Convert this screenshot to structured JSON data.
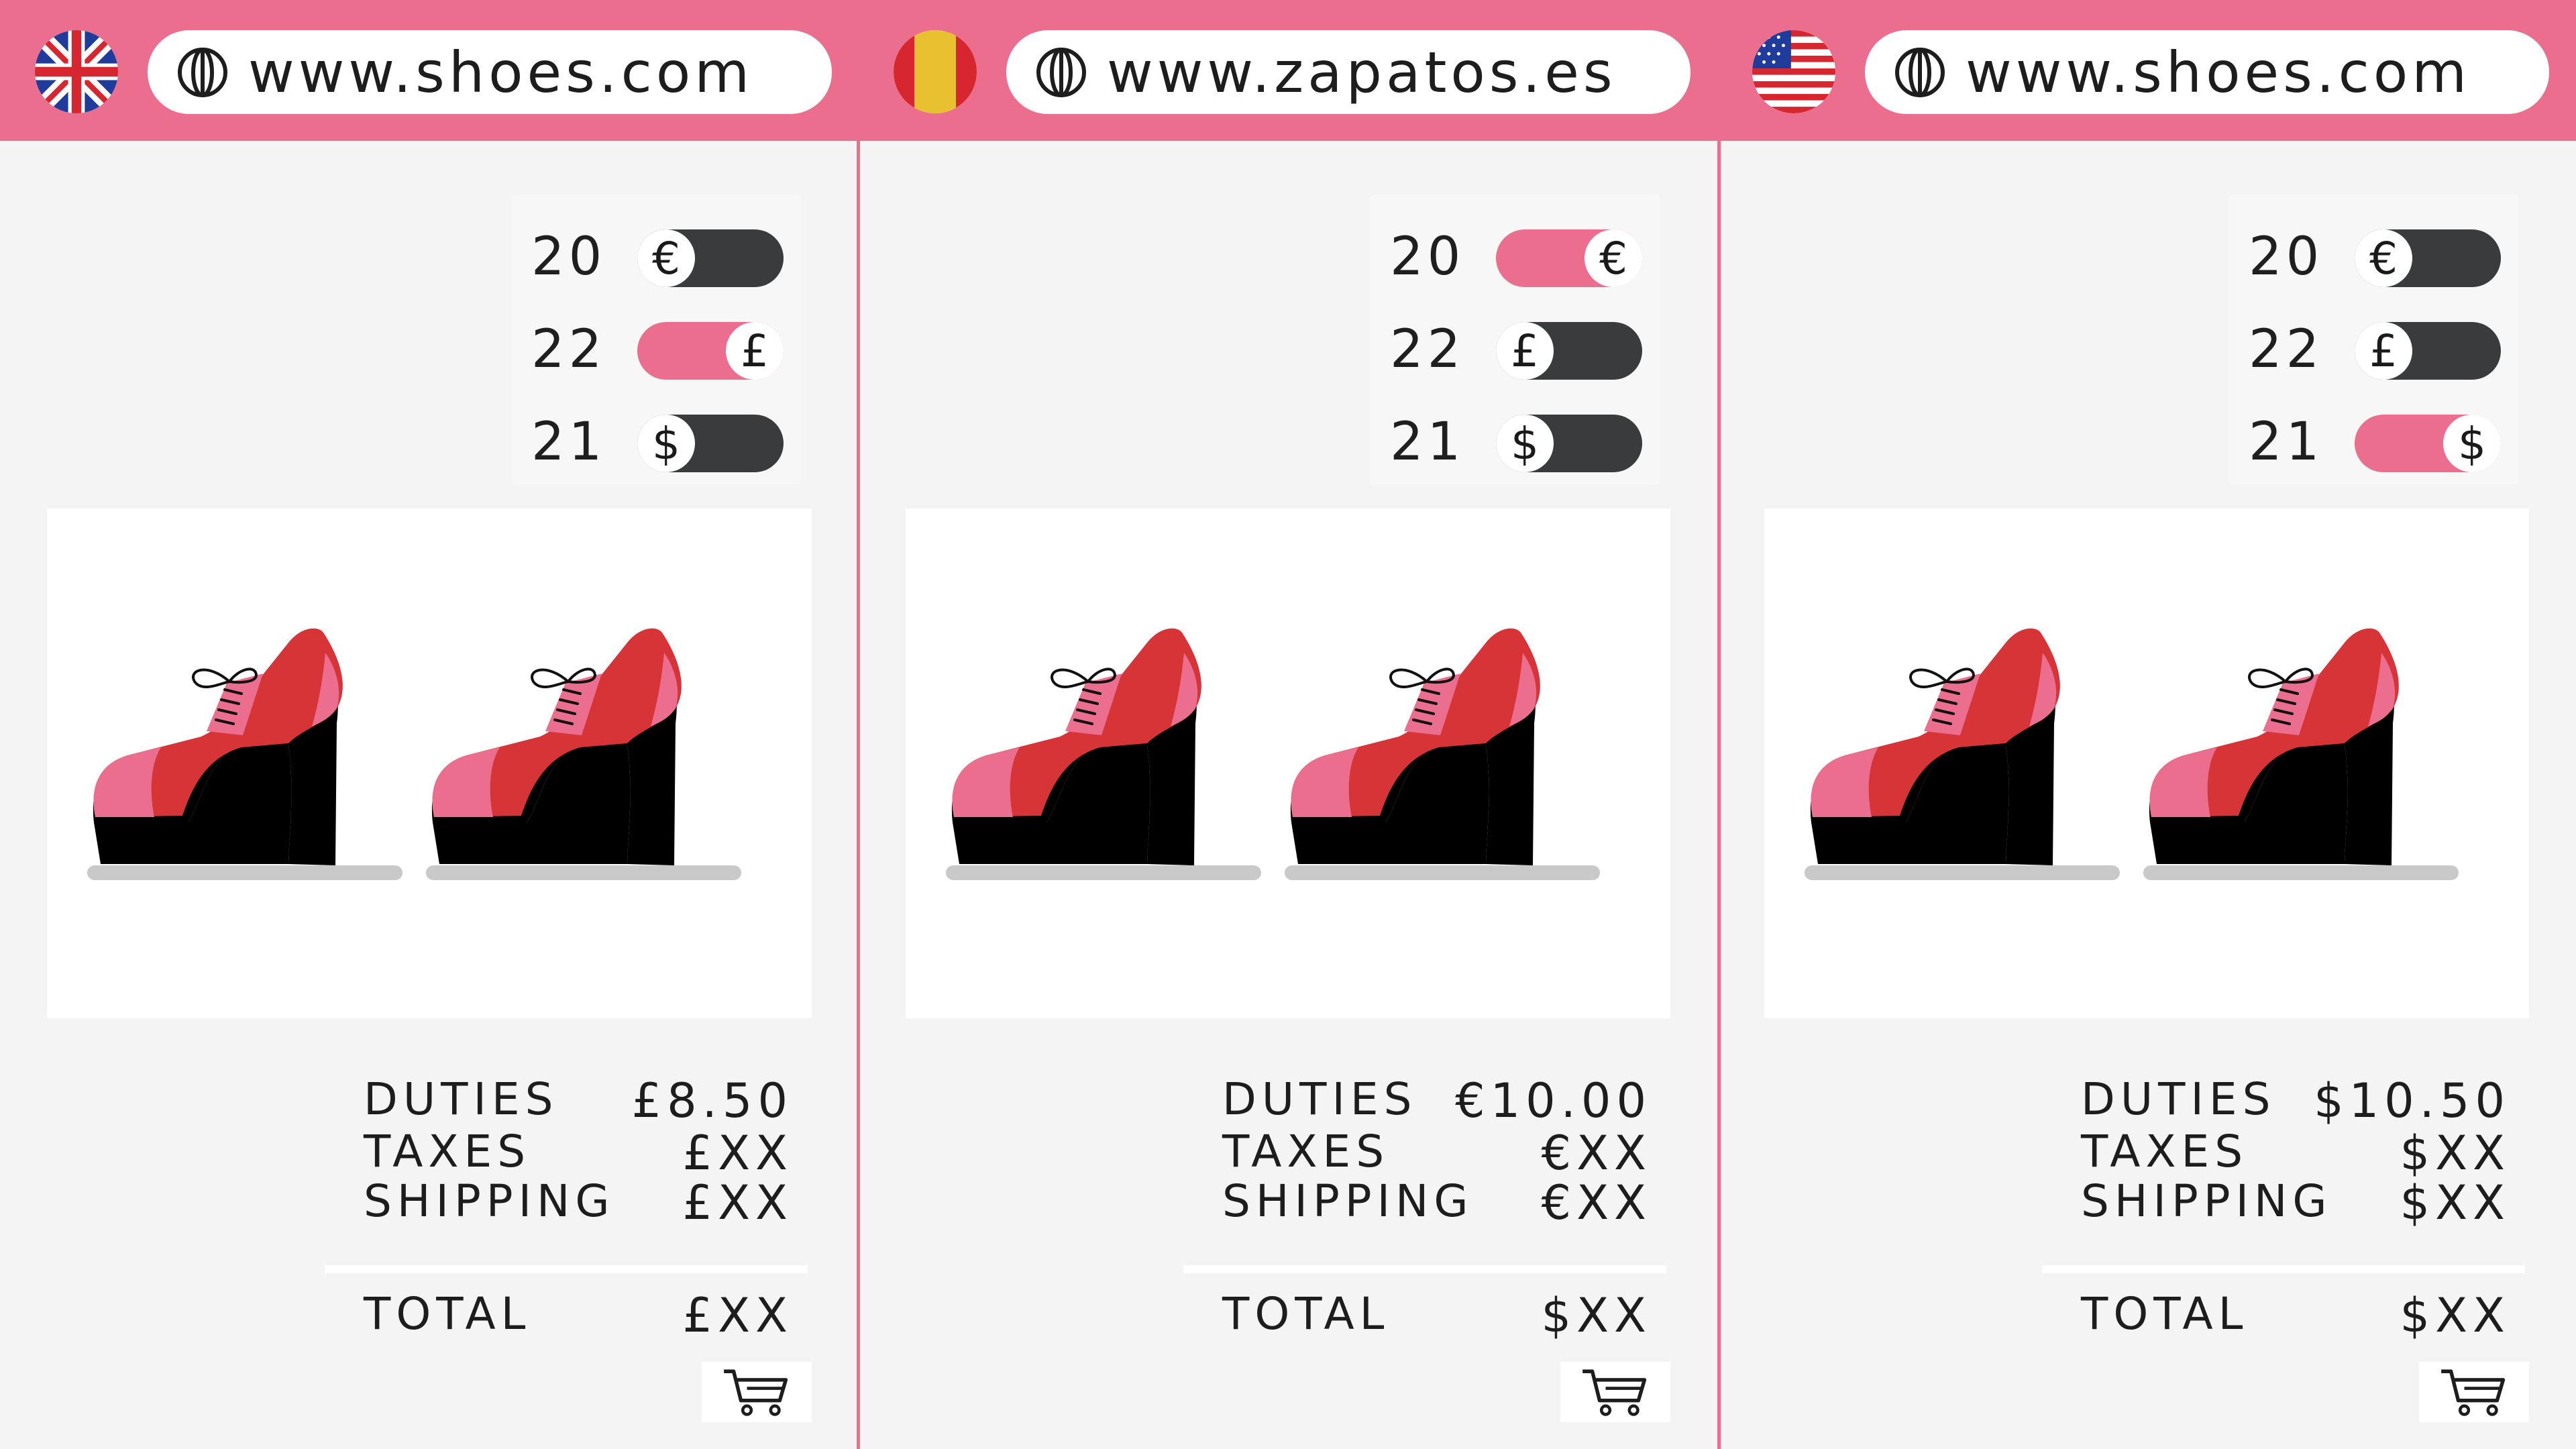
{
  "colors": {
    "accent": "#ec6e8f",
    "toggle_off": "#3a3b3d",
    "shoe_red": "#d73438",
    "shoe_pink": "#ec6e8f",
    "sole": "#000000"
  },
  "icons": {
    "globe": "globe-icon",
    "cart": "shopping-cart-icon"
  },
  "panels": [
    {
      "region": "UK",
      "flag": "uk-flag-icon",
      "url": "www.shoes.com",
      "sizes": [
        {
          "number": "20",
          "currency": "€",
          "selected": false
        },
        {
          "number": "22",
          "currency": "£",
          "selected": true
        },
        {
          "number": "21",
          "currency": "$",
          "selected": false
        }
      ],
      "summary": {
        "duties_label": "DUTIES",
        "duties_value": "£8.50",
        "taxes_label": "TAXES",
        "taxes_value": "£XX",
        "shipping_label": "SHIPPING",
        "shipping_value": "£XX",
        "total_label": "TOTAL",
        "total_value": "£XX"
      }
    },
    {
      "region": "Spain",
      "flag": "spain-flag-icon",
      "url": "www.zapatos.es",
      "sizes": [
        {
          "number": "20",
          "currency": "€",
          "selected": true
        },
        {
          "number": "22",
          "currency": "£",
          "selected": false
        },
        {
          "number": "21",
          "currency": "$",
          "selected": false
        }
      ],
      "summary": {
        "duties_label": "DUTIES",
        "duties_value": "€10.00",
        "taxes_label": "TAXES",
        "taxes_value": "€XX",
        "shipping_label": "SHIPPING",
        "shipping_value": "€XX",
        "total_label": "TOTAL",
        "total_value": "$XX"
      }
    },
    {
      "region": "US",
      "flag": "us-flag-icon",
      "url": "www.shoes.com",
      "sizes": [
        {
          "number": "20",
          "currency": "€",
          "selected": false
        },
        {
          "number": "22",
          "currency": "£",
          "selected": false
        },
        {
          "number": "21",
          "currency": "$",
          "selected": true
        }
      ],
      "summary": {
        "duties_label": "DUTIES",
        "duties_value": "$10.50",
        "taxes_label": "TAXES",
        "taxes_value": "$XX",
        "shipping_label": "SHIPPING",
        "shipping_value": "$XX",
        "total_label": "TOTAL",
        "total_value": "$XX"
      }
    }
  ]
}
